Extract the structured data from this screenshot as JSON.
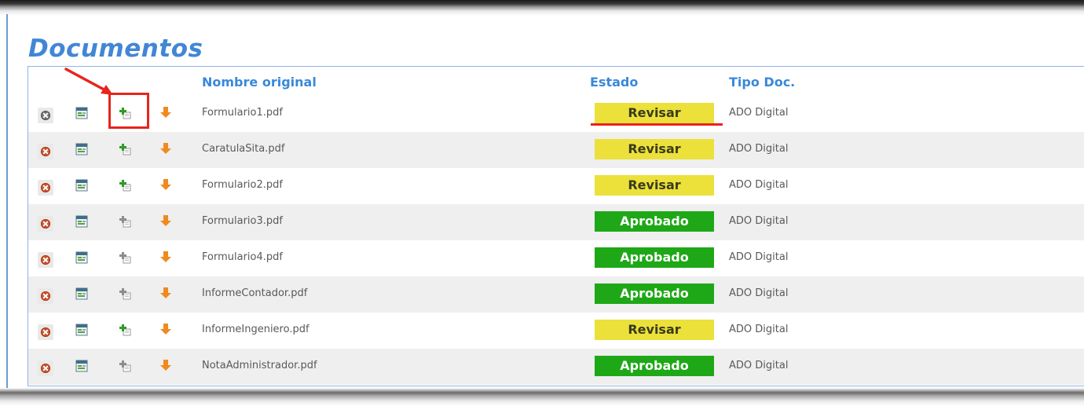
{
  "section_title": "Documentos",
  "table": {
    "headers": {
      "nombre": "Nombre original",
      "estado": "Estado",
      "tipo": "Tipo Doc."
    },
    "rows": [
      {
        "nombre": "Formulario1.pdf",
        "estado": "Revisar",
        "tipo": "ADO Digital",
        "upload_enabled": true,
        "delete_enabled": false
      },
      {
        "nombre": "CaratulaSita.pdf",
        "estado": "Revisar",
        "tipo": "ADO Digital",
        "upload_enabled": true,
        "delete_enabled": true
      },
      {
        "nombre": "Formulario2.pdf",
        "estado": "Revisar",
        "tipo": "ADO Digital",
        "upload_enabled": true,
        "delete_enabled": true
      },
      {
        "nombre": "Formulario3.pdf",
        "estado": "Aprobado",
        "tipo": "ADO Digital",
        "upload_enabled": false,
        "delete_enabled": true
      },
      {
        "nombre": "Formulario4.pdf",
        "estado": "Aprobado",
        "tipo": "ADO Digital",
        "upload_enabled": false,
        "delete_enabled": true
      },
      {
        "nombre": "InformeContador.pdf",
        "estado": "Aprobado",
        "tipo": "ADO Digital",
        "upload_enabled": false,
        "delete_enabled": true
      },
      {
        "nombre": "InformeIngeniero.pdf",
        "estado": "Revisar",
        "tipo": "ADO Digital",
        "upload_enabled": true,
        "delete_enabled": true
      },
      {
        "nombre": "NotaAdministrador.pdf",
        "estado": "Aprobado",
        "tipo": "ADO Digital",
        "upload_enabled": false,
        "delete_enabled": true
      }
    ]
  },
  "icons": {
    "delete": "delete-icon",
    "view": "window-view-icon",
    "upload": "add-copy-icon",
    "download": "download-arrow-icon"
  },
  "colors": {
    "title": "#4286d6",
    "header_text": "#3a88d8",
    "revisar": "#ebe13a",
    "aprobado": "#1ea817",
    "annotation": "#e8241c",
    "row_alt": "#efefef"
  }
}
